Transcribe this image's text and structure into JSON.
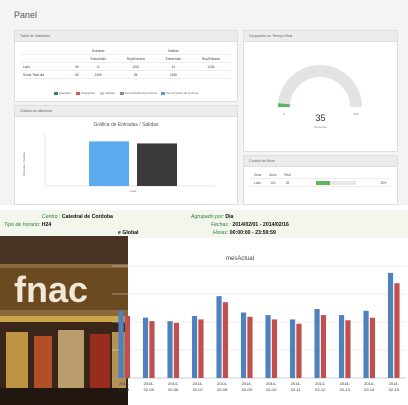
{
  "page_title": "Panel",
  "panels": {
    "tabla_title": "Tabla de Visitantes",
    "grafica_title": "Gráfica de afluencia",
    "gauge_title": "Ocupación en Tiempo Real",
    "control_title": "Control de Aforo"
  },
  "tabla": {
    "group_headers": [
      "",
      "",
      "Entradas",
      "",
      "Salidas",
      ""
    ],
    "sub_headers": [
      "",
      "",
      "Entrar/salir",
      "Rep/Entrada",
      "Entrar/salir",
      "Rep/Entrada"
    ],
    "rows": [
      [
        "Lado",
        "55",
        "11",
        "1201",
        "14",
        "1246"
      ],
      [
        "Suma Total dia",
        "65",
        "1490",
        "86",
        "1368",
        ""
      ]
    ],
    "legend": [
      {
        "label": "Entradas",
        "color": "#2e8b57"
      },
      {
        "label": "Ocupación",
        "color": "#d9534f"
      },
      {
        "label": "Salidas",
        "color": "#cccccc"
      },
      {
        "label": "Suma Media de la Zona",
        "color": "#888888"
      },
      {
        "label": "Suma Sabrá de la Zona",
        "color": "#5b9bd5"
      }
    ]
  },
  "grafica": {
    "chart_title": "Gráfica de Entradas / Salidas",
    "y_label": "Entradas / Salidas",
    "x_label": "Lado"
  },
  "gauge": {
    "value": "35",
    "unit": "Personas",
    "min_label": "0",
    "max_label": "100",
    "fraction": 0.35
  },
  "control": {
    "headers": [
      "Zona",
      "Aforo",
      "Real",
      ""
    ],
    "row": [
      "Lado",
      "100",
      "35",
      "35%"
    ],
    "fill_fraction": 0.35
  },
  "report": {
    "centro_key": "Centro :",
    "centro_value": "Catedral de Cordoba",
    "tipo_key": "Tipo de horario:",
    "tipo_value": "H24",
    "global_text": "e Global",
    "agrupado_key": "Agrupado por:",
    "agrupado_value": "Dia",
    "fechas_key": "Fechas :",
    "fechas_value": "2014/02/01  -  2014/02/16",
    "horas_key": "Horas:",
    "horas_value": "00:00:00  -  23:59:59"
  },
  "photo": {
    "sign_text": "fnac"
  },
  "colors": {
    "series_blue": "#4f81bd",
    "series_red": "#c0504d",
    "gauge_fill": "#5cb85c",
    "bar_blue": "#5aaaf0",
    "bar_dark": "#3a3a3a"
  },
  "chart_data": [
    {
      "type": "bar",
      "title": "Gráfica de Entradas / Salidas",
      "ylabel": "Entradas / Salidas",
      "xlabel": "Lado",
      "categories": [
        "Lado"
      ],
      "series": [
        {
          "name": "Entradas",
          "values": [
            1201
          ]
        },
        {
          "name": "Salidas",
          "values": [
            1146
          ]
        }
      ],
      "ylim": [
        0,
        1400
      ]
    },
    {
      "type": "bar",
      "title": "mesActual",
      "categories": [
        "2014-02-04",
        "2014-02-05",
        "2014-02-06",
        "2014-02-07",
        "2014-02-08",
        "2014-02-09",
        "2014-02-10",
        "2014-02-11",
        "2014-02-12",
        "2014-02-13",
        "2014-02-14",
        "2014-02-15"
      ],
      "series": [
        {
          "name": "",
          "values": [
            78,
            70,
            66,
            72,
            95,
            76,
            73,
            68,
            80,
            73,
            78,
            122
          ]
        },
        {
          "name": "",
          "values": [
            72,
            66,
            64,
            68,
            88,
            71,
            68,
            63,
            73,
            67,
            70,
            110
          ]
        }
      ],
      "ylim": [
        0,
        130
      ],
      "grid": true
    }
  ]
}
